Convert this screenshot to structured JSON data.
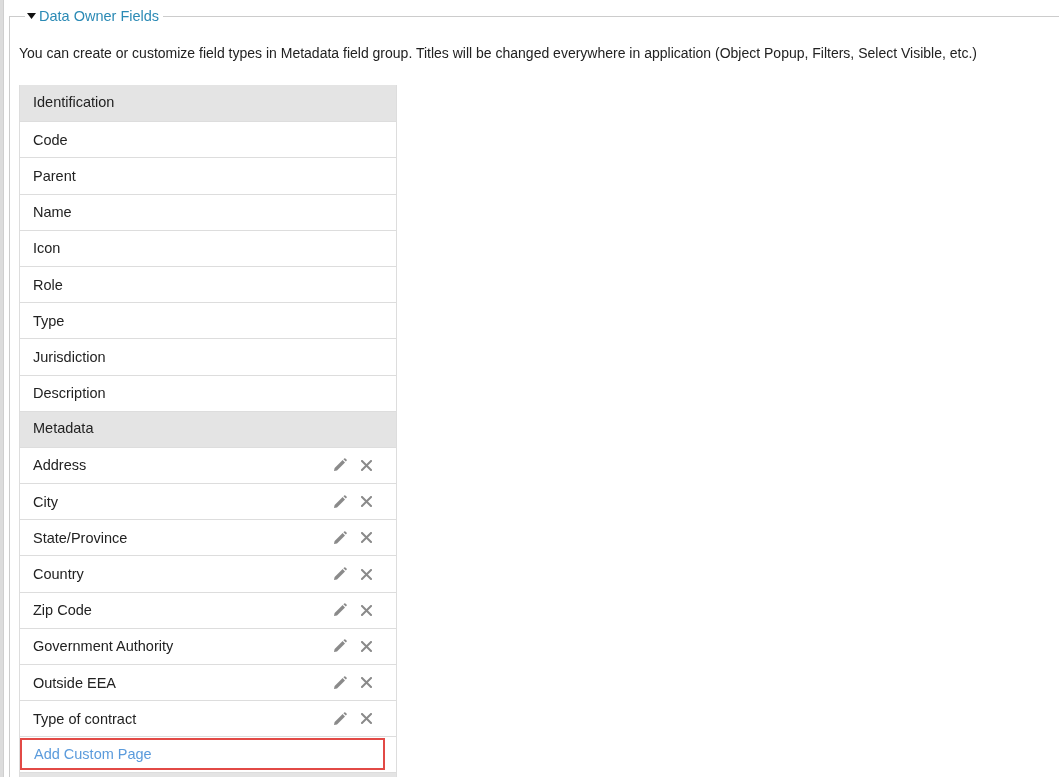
{
  "section": {
    "title": "Data Owner Fields",
    "expanded": true,
    "description": "You can create or customize field types in Metadata field group. Titles will be changed everywhere in application (Object Popup, Filters, Select Visible, etc.)"
  },
  "field_groups": [
    {
      "title": "Identification",
      "fields": [
        {
          "label": "Code",
          "editable": false
        },
        {
          "label": "Parent",
          "editable": false
        },
        {
          "label": "Name",
          "editable": false
        },
        {
          "label": "Icon",
          "editable": false
        },
        {
          "label": "Role",
          "editable": false
        },
        {
          "label": "Type",
          "editable": false
        },
        {
          "label": "Jurisdiction",
          "editable": false
        },
        {
          "label": "Description",
          "editable": false
        }
      ]
    },
    {
      "title": "Metadata",
      "fields": [
        {
          "label": "Address",
          "editable": true
        },
        {
          "label": "City",
          "editable": true
        },
        {
          "label": "State/Province",
          "editable": true
        },
        {
          "label": "Country",
          "editable": true
        },
        {
          "label": "Zip Code",
          "editable": true
        },
        {
          "label": "Government Authority",
          "editable": true
        },
        {
          "label": "Outside EEA",
          "editable": true
        },
        {
          "label": "Type of contract",
          "editable": true
        }
      ]
    }
  ],
  "add_link": {
    "label": "Add Custom Page",
    "highlighted": true
  }
}
